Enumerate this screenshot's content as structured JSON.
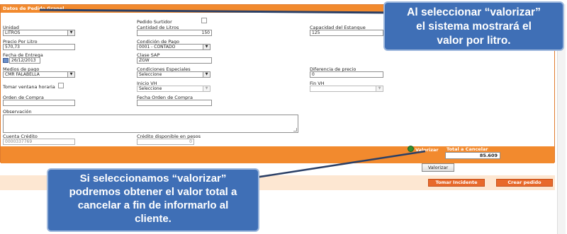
{
  "header": {
    "title": "Datos de Pedido Granel"
  },
  "form": {
    "pedido_surtidor": {
      "label": "Pedido Surtidor"
    },
    "unidad": {
      "label": "Unidad",
      "value": "LITROS"
    },
    "cantidad_litros": {
      "label": "Cantidad de Litros",
      "value": "150"
    },
    "capacidad_estanque": {
      "label": "Capacidad del Estanque",
      "value": "125"
    },
    "precio_por_litro": {
      "label": "Precio Por Litro",
      "value": "570,73"
    },
    "condicion_pago": {
      "label": "Condición de Pago",
      "value": "0001 - CONTADO"
    },
    "fecha_entrega": {
      "label": "Fecha de Entrega",
      "value": "26/12/2013"
    },
    "clase_sap": {
      "label": "Clase SAP",
      "value": "ZGW"
    },
    "medios_pago": {
      "label": "Medios de pago",
      "value": "CMR FALABELLA"
    },
    "condiciones_especiales": {
      "label": "Condiciones Especiales",
      "value": "Seleccione"
    },
    "diferencia_precio": {
      "label": "Diferencia de precio",
      "value": "0"
    },
    "tomar_ventana": {
      "label": "Tomar ventana horaria"
    },
    "inicio_vh": {
      "label": "Inicio VH",
      "value": "Seleccione"
    },
    "fin_vh": {
      "label": "Fin VH",
      "value": ""
    },
    "orden_compra": {
      "label": "Orden de Compra",
      "value": ""
    },
    "fecha_orden_compra": {
      "label": "Fecha Orden de Compra",
      "value": ""
    },
    "observacion": {
      "label": "Observación",
      "value": ""
    },
    "cuenta_credito": {
      "label": "Cuenta Crédito",
      "value": "0000337769"
    },
    "credito_disponible": {
      "label": "Crédito disponible en pesos",
      "value": "0"
    }
  },
  "totals": {
    "valorizar_radio_label": "Valorizar",
    "total_label": "Total a Cancelar",
    "total_value": "85.609"
  },
  "buttons": {
    "valorizar": "Valorizar",
    "tomar_incidente": "Tomar Incidente",
    "crear_pedido": "Crear pedido"
  },
  "callouts": {
    "top": [
      "Al seleccionar “valorizar”",
      "el sistema mostrará el",
      "valor por litro."
    ],
    "bottom": [
      "Si seleccionamos “valorizar”",
      "podremos obtener el valor total a",
      "cancelar a fin de informarlo al",
      "cliente."
    ]
  },
  "icons": {
    "dropdown": "chevron-down-icon",
    "calendar": "calendar-icon",
    "radio": "radio-selected-icon"
  },
  "colors": {
    "accent": "#f28a2e",
    "callout": "#3f6fb6",
    "action_button": "#e8692b"
  }
}
